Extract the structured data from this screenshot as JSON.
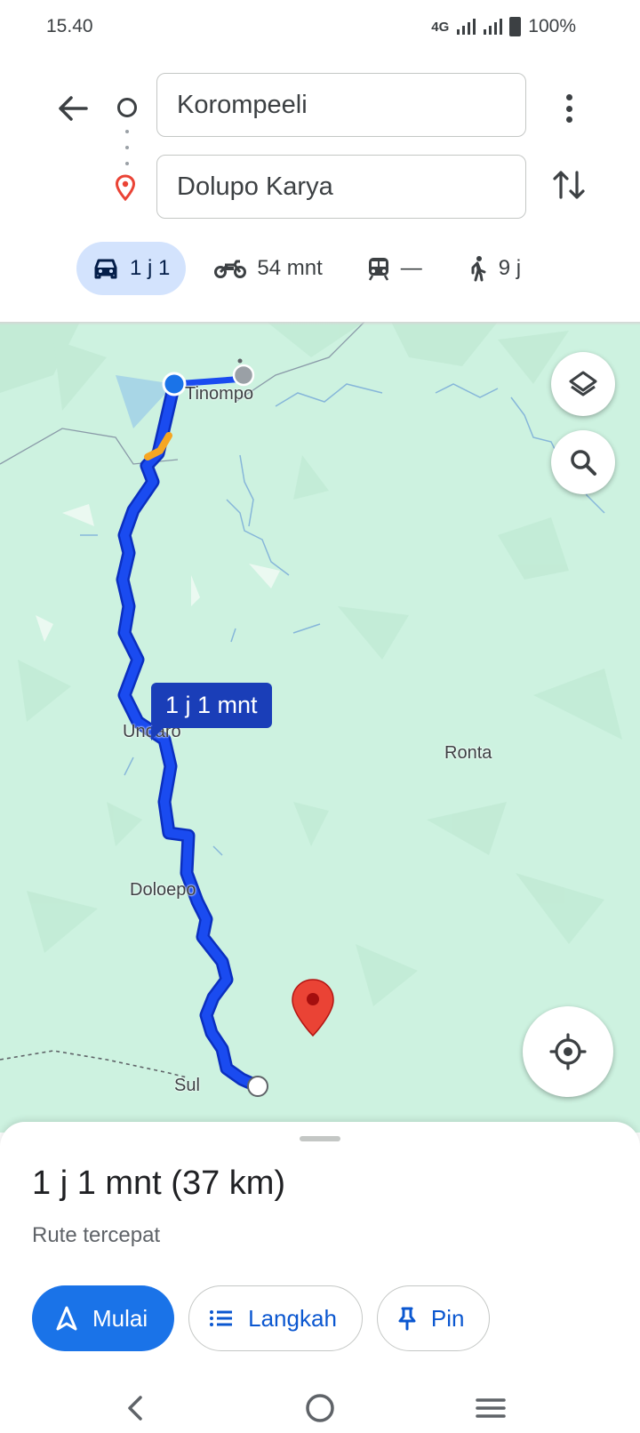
{
  "status": {
    "time": "15.40",
    "network": "4G",
    "battery": "100%"
  },
  "directions": {
    "origin": "Korompeeli",
    "destination": "Dolupo Karya"
  },
  "modes": [
    {
      "name": "car",
      "label": "1 j 1"
    },
    {
      "name": "motorcycle",
      "label": "54 mnt"
    },
    {
      "name": "transit",
      "label": "—"
    },
    {
      "name": "walk",
      "label": "9 j"
    }
  ],
  "map": {
    "places": [
      "Tinompo",
      "Undaro",
      "Ronta",
      "Doloepo",
      "Sul"
    ],
    "route_label": "1 j 1 mnt",
    "route_color": "#1a3ee6"
  },
  "sheet": {
    "summary": "1 j 1 mnt (37 km)",
    "subtitle": "Rute tercepat",
    "start_label": "Mulai",
    "steps_label": "Langkah",
    "pin_label": "Pin"
  },
  "colors": {
    "accent": "#1a73e8",
    "map_bg": "#cdf2e0",
    "active_mode_bg": "#d3e3fd",
    "destination_marker": "#ea4335"
  }
}
